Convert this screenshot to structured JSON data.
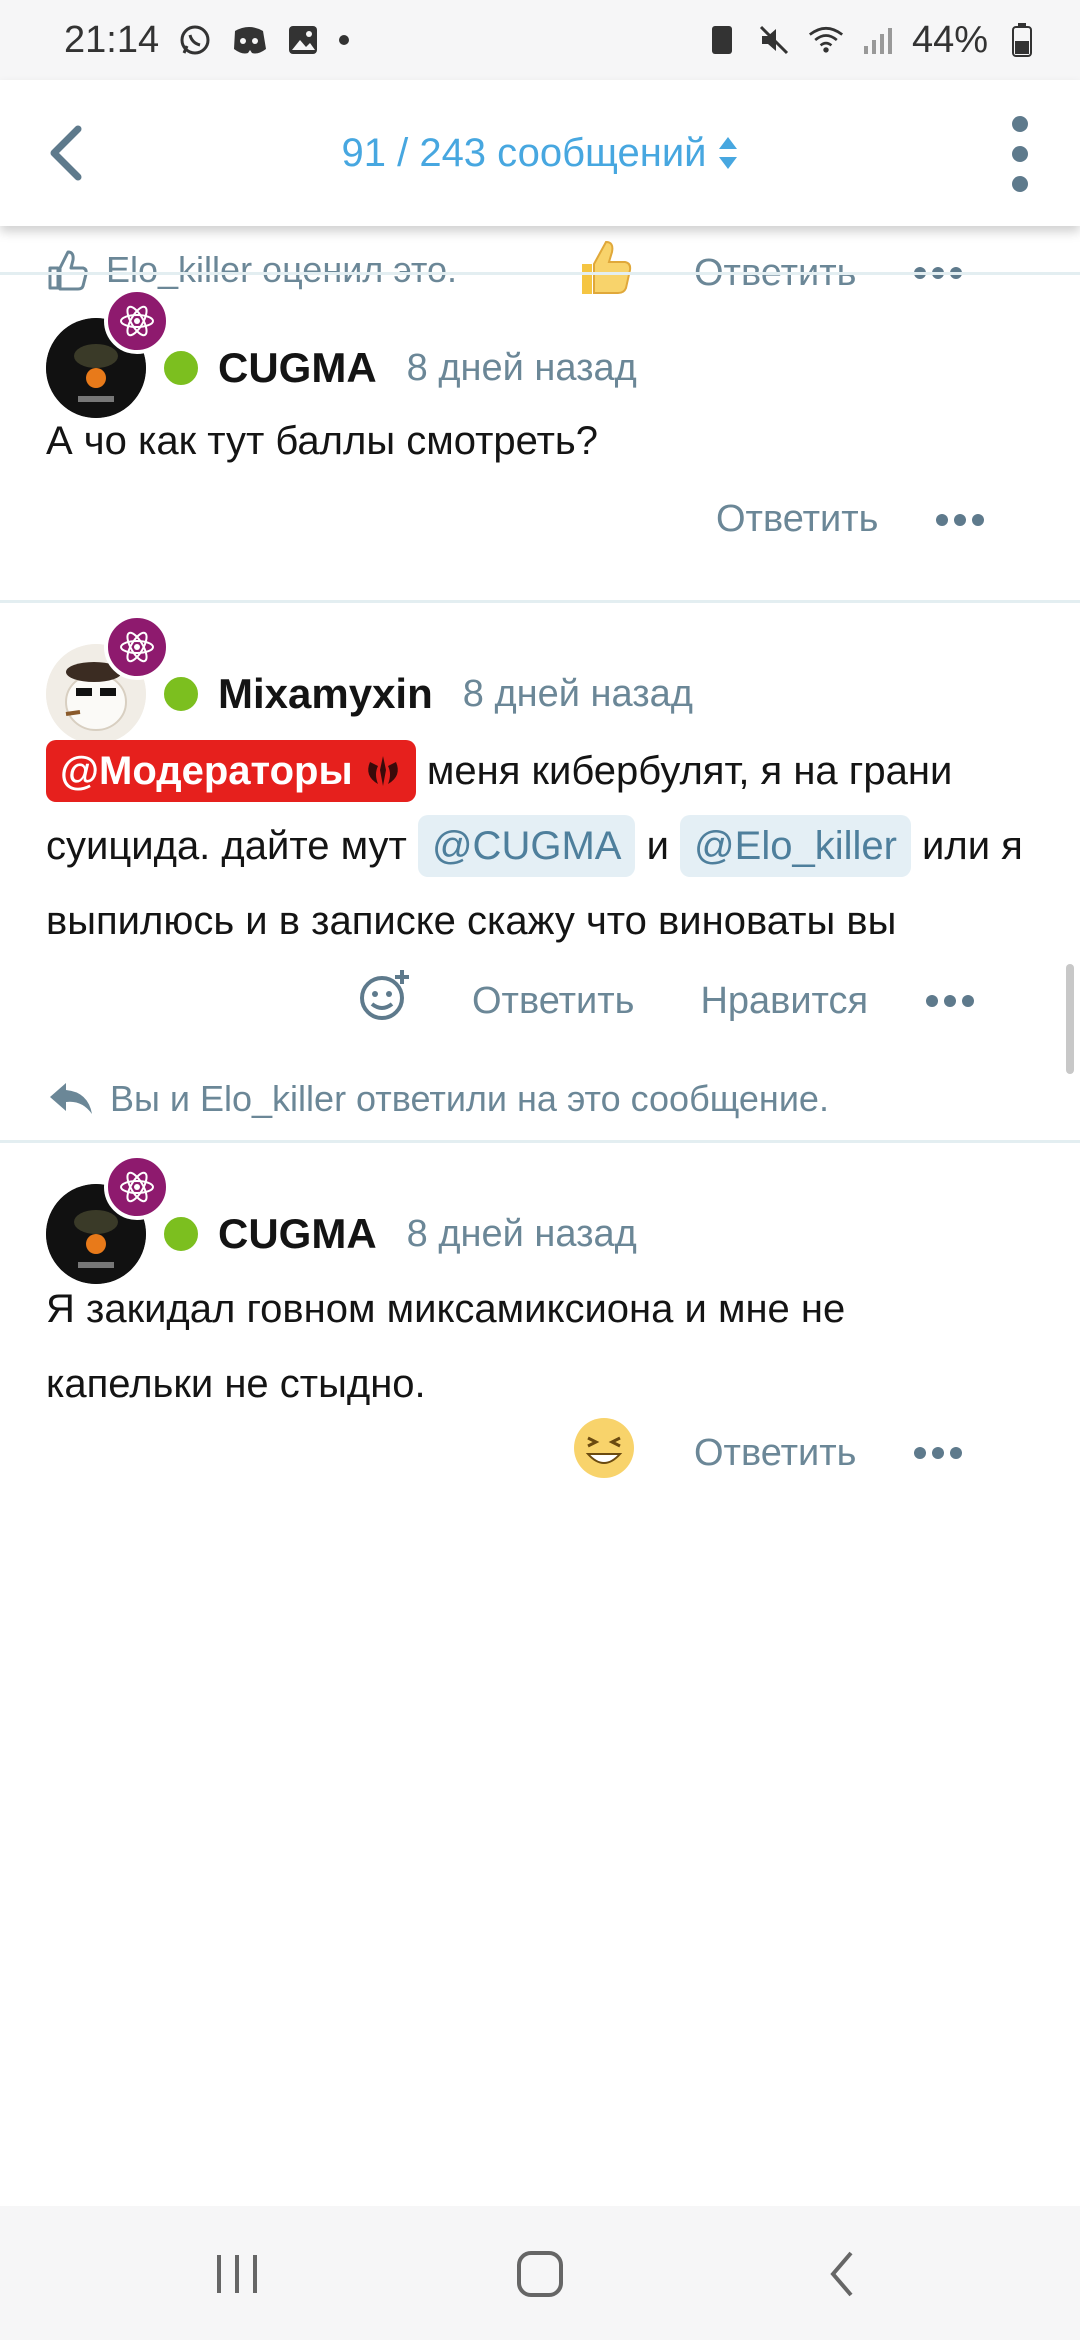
{
  "status_bar": {
    "time": "21:14",
    "battery": "44%"
  },
  "topbar": {
    "title": "91 / 243 сообщений"
  },
  "prev_post": {
    "liked_text": "Elo_killer оценил это.",
    "reply_label": "Ответить"
  },
  "posts": [
    {
      "author": "CUGMA",
      "time": "8 дней назад",
      "text": "А чо как тут баллы смотреть?",
      "reply_label": "Ответить"
    },
    {
      "author": "Mixamyxin",
      "time": "8 дней назад",
      "mention_moderators": "@Модераторы",
      "text_part1": " меня кибербулят, я на грани суицида. дайте мут ",
      "mention_cugma": "@CUGMA",
      "text_part2": " и ",
      "mention_elo": "@Elo_killer",
      "text_part3": " или я выпилюсь и в записке скажу что виноваты вы",
      "reply_label": "Ответить",
      "like_label": "Нравится",
      "replied_text": "Вы и Elo_killer ответили на это сообщение."
    },
    {
      "author": "CUGMA",
      "time": "8 дней назад",
      "text": "Я закидал говном миксамиксиона и мне не капельки не стыдно.",
      "reply_label": "Ответить"
    }
  ],
  "colors": {
    "accent": "#47a7e0",
    "online": "#7cbf1f",
    "badge": "#8e1a6e",
    "mod_red": "#e6201d",
    "muted": "#6b8797"
  }
}
